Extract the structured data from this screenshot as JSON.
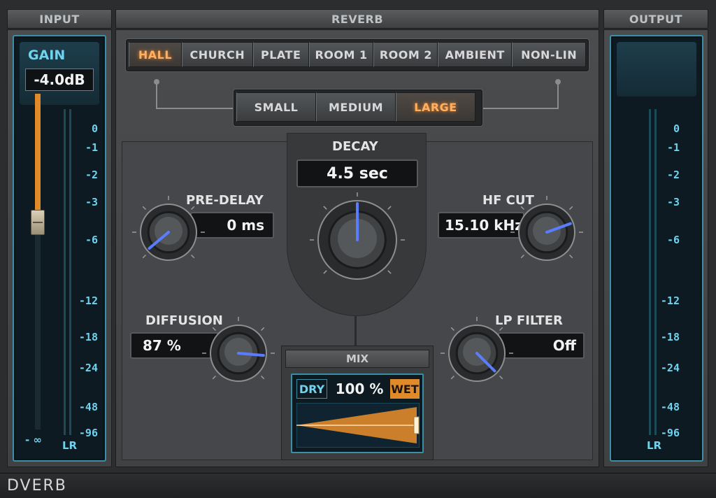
{
  "input": {
    "header": "INPUT",
    "gain_label": "GAIN",
    "gain_value": "-4.0dB",
    "fader_min_label": "- ∞",
    "lr_label": "LR",
    "scale": [
      "0",
      "-1",
      "-2",
      "-3",
      "-6",
      "-12",
      "-18",
      "-24",
      "-48",
      "-96"
    ]
  },
  "output": {
    "header": "OUTPUT",
    "lr_label": "LR",
    "scale": [
      "0",
      "-1",
      "-2",
      "-3",
      "-6",
      "-12",
      "-18",
      "-24",
      "-48",
      "-96"
    ]
  },
  "reverb": {
    "header": "REVERB",
    "types": [
      "HALL",
      "CHURCH",
      "PLATE",
      "ROOM 1",
      "ROOM 2",
      "AMBIENT",
      "NON-LIN"
    ],
    "selected_type": "HALL",
    "sizes": [
      "SMALL",
      "MEDIUM",
      "LARGE"
    ],
    "selected_size": "LARGE"
  },
  "controls": {
    "decay": {
      "label": "DECAY",
      "value": "4.5 sec"
    },
    "pre_delay": {
      "label": "PRE-DELAY",
      "value": "0 ms"
    },
    "hf_cut": {
      "label": "HF CUT",
      "value": "15.10 kHz"
    },
    "diffusion": {
      "label": "DIFFUSION",
      "value": "87 %"
    },
    "lp_filter": {
      "label": "LP FILTER",
      "value": "Off"
    }
  },
  "mix": {
    "header": "MIX",
    "dry_label": "DRY",
    "value": "100 %",
    "wet_label": "WET",
    "wet_fraction": 1.0
  },
  "footer": {
    "brand": "DVERB"
  },
  "colors": {
    "accent_blue": "#5a7dff",
    "meter_cyan": "#6fd2ef",
    "active_orange": "#ffb060",
    "fader_orange": "#e08a2a"
  }
}
